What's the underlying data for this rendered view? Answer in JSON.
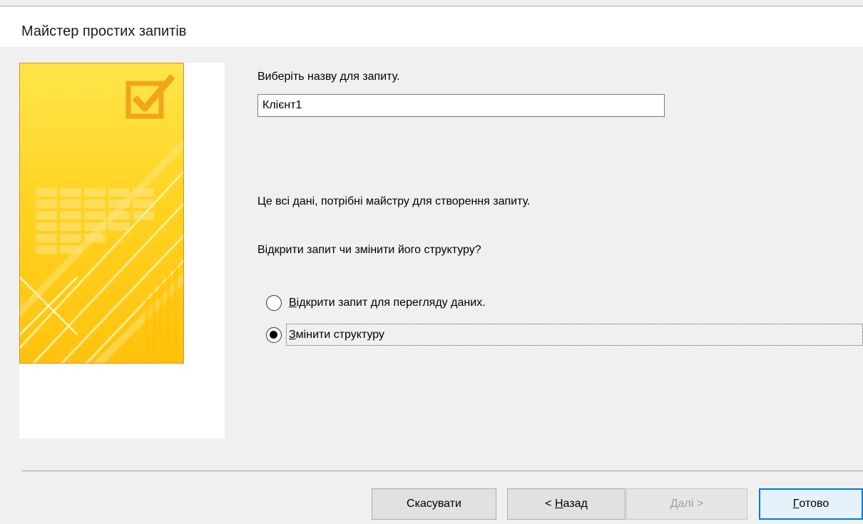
{
  "window": {
    "title": "Майстер простих запитів"
  },
  "form": {
    "name_prompt": "Виберіть назву для запиту.",
    "name_value": "Клієнт1",
    "info_text": "Це всі дані, потрібні майстру для створення запиту.",
    "question": "Відкрити запит чи змінити його структуру?"
  },
  "options": [
    {
      "accel": "В",
      "rest": "ідкрити запит для перегляду даних.",
      "selected": false
    },
    {
      "accel": "З",
      "rest": "мінити структуру",
      "selected": true
    }
  ],
  "buttons": {
    "cancel": "Скасувати",
    "back_prefix": "< ",
    "back_accel": "Н",
    "back_rest": "азад",
    "next_accel": "Д",
    "next_rest": "алі >",
    "finish_accel": "Г",
    "finish_rest": "отово"
  },
  "colors": {
    "art_yellow": "#ffd21f",
    "art_border": "#e08a2a",
    "default_button": "#0078d7"
  },
  "icons": {
    "wizard_art": "checkbox-check-icon"
  }
}
